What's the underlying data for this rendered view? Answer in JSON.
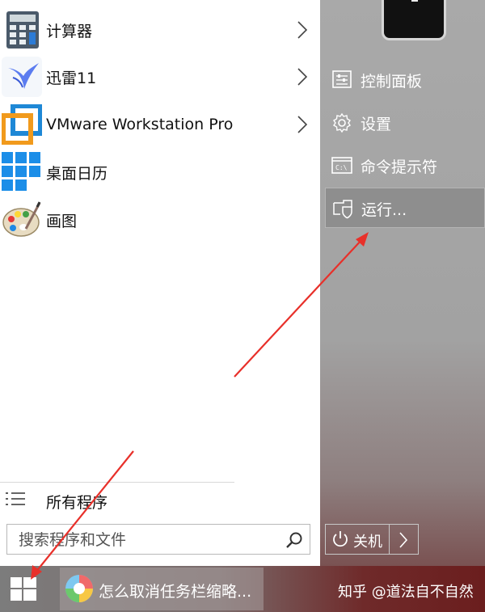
{
  "start_menu": {
    "apps": [
      {
        "label": "计算器",
        "icon": "calculator-icon"
      },
      {
        "label": "迅雷11",
        "icon": "xunlei-bird-icon"
      },
      {
        "label": "VMware Workstation Pro",
        "icon": "vmware-icon"
      },
      {
        "label": "桌面日历",
        "icon": "desktop-calendar-icon"
      },
      {
        "label": "画图",
        "icon": "paint-palette-icon"
      }
    ],
    "all_programs_label": "所有程序",
    "search_placeholder": "搜索程序和文件"
  },
  "right_panel": {
    "items": [
      {
        "label": "控制面板",
        "icon": "control-panel-icon"
      },
      {
        "label": "设置",
        "icon": "gear-icon"
      },
      {
        "label": "命令提示符",
        "icon": "command-prompt-icon"
      },
      {
        "label": "运行...",
        "icon": "run-icon"
      }
    ],
    "shutdown_label": "关机"
  },
  "taskbar": {
    "task_label": "怎么取消任务栏缩略...",
    "watermark": "知乎 @道法自不自然"
  },
  "colors": {
    "annotation_arrow": "#e8302a",
    "right_panel_bg": "#a6a6a6",
    "taskbar_red": "#6b1e1e"
  }
}
